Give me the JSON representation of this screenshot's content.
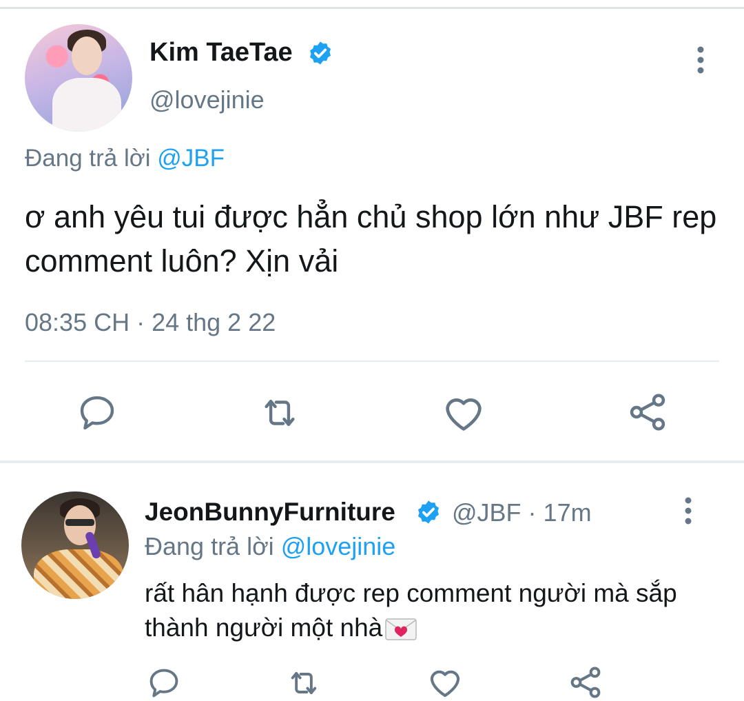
{
  "main_tweet": {
    "author_name": "Kim TaeTae",
    "author_handle": "@lovejinie",
    "verified": true,
    "replying_prefix": "Đang trả lời",
    "replying_to": "@JBF",
    "text": "ơ anh yêu tui được hẳn chủ shop lớn như JBF rep comment luôn? Xịn vải",
    "timestamp": "08:35 CH · 24 thg 2 22",
    "actions": [
      "reply-icon",
      "retweet-icon",
      "like-icon",
      "share-icon"
    ]
  },
  "reply_tweet": {
    "author_name": "JeonBunnyFurniture",
    "author_handle": "@JBF",
    "time_ago": "17m",
    "separator": " · ",
    "verified": true,
    "replying_prefix": "Đang trả lời",
    "replying_to": "@lovejinie",
    "text": "rất hân hạnh được rep comment người mà sắp thành người một nhà",
    "emoji": "love-letter-icon",
    "actions": [
      "reply-icon",
      "retweet-icon",
      "like-icon",
      "share-icon"
    ]
  },
  "colors": {
    "accent": "#1da1f2",
    "secondary_text": "#657786",
    "primary_text": "#14171a",
    "divider": "#e6ecf0"
  }
}
